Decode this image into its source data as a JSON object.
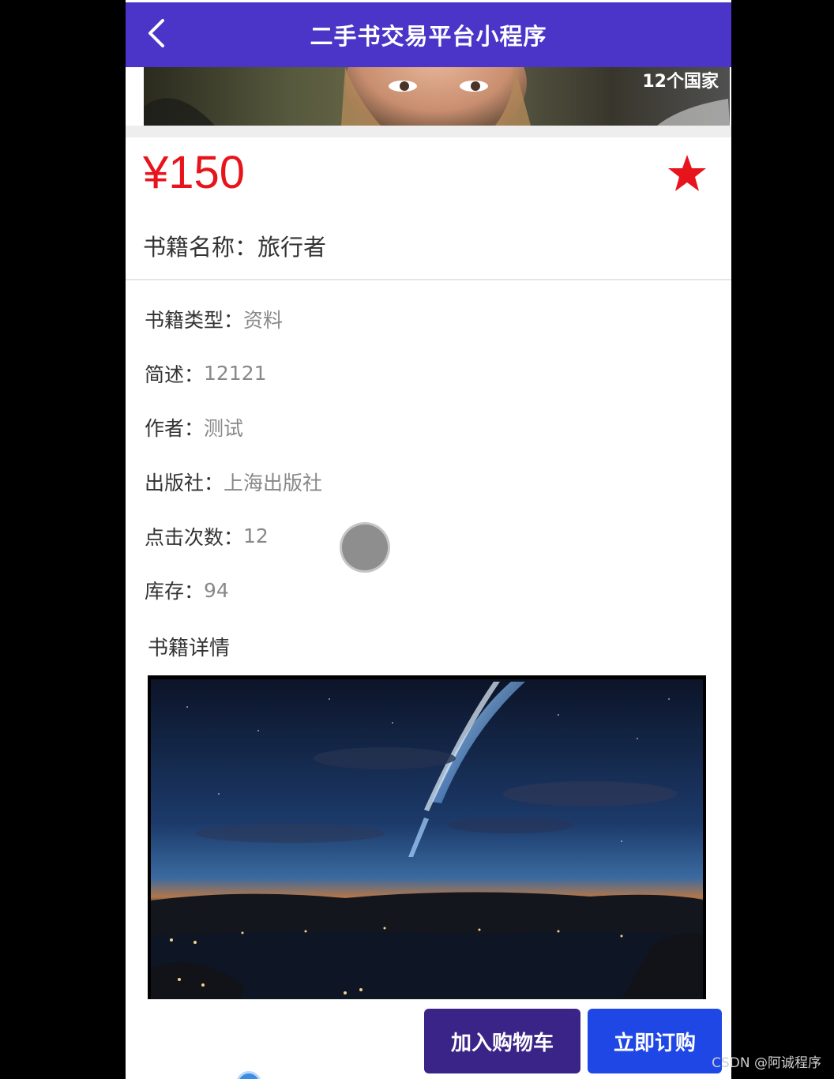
{
  "header": {
    "title": "二手书交易平台小程序",
    "back_icon": "chevron-left-icon",
    "background_color": "#4a35c8"
  },
  "banner": {
    "caption": "12个国家"
  },
  "product": {
    "price": "¥150",
    "price_color": "#e8141b",
    "favorite_icon": "star-icon",
    "favorite_color": "#e8141b",
    "name_label": "书籍名称：",
    "name_value": "旅行者"
  },
  "info": [
    {
      "label": "书籍类型：",
      "value": "资料"
    },
    {
      "label": "简述：",
      "value": "12121"
    },
    {
      "label": "作者：",
      "value": "测试"
    },
    {
      "label": "出版社：",
      "value": "上海出版社"
    },
    {
      "label": "点击次数：",
      "value": "12"
    },
    {
      "label": "库存：",
      "value": "94"
    }
  ],
  "detail": {
    "title": "书籍详情"
  },
  "actions": {
    "add_to_cart": "加入购物车",
    "buy_now": "立即订购"
  },
  "watermark": "CSDN @阿诚程序"
}
